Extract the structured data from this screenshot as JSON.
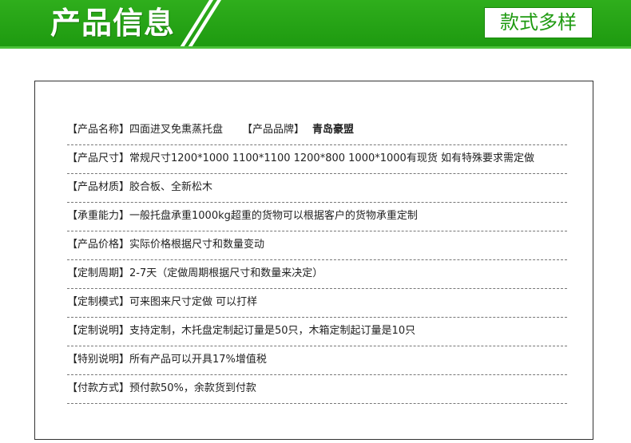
{
  "banner": {
    "title": "产品信息",
    "badge": "款式多样"
  },
  "rows": [
    {
      "label": "【产品名称】",
      "value": "四面进叉免熏蒸托盘",
      "label2": "【产品品牌】",
      "value2": "青岛豪盟"
    },
    {
      "label": "【产品尺寸】",
      "value": "常规尺寸1200*1000  1100*1100 1200*800 1000*1000有现货 如有特殊要求需定做"
    },
    {
      "label": "【产品材质】",
      "value": "胶合板、全新松木"
    },
    {
      "label": "【承重能力】",
      "value": "一般托盘承重1000kg超重的货物可以根据客户的货物承重定制"
    },
    {
      "label": "【产品价格】",
      "value": "实际价格根据尺寸和数量变动"
    },
    {
      "label": "【定制周期】",
      "value": "2-7天（定做周期根据尺寸和数量来决定）"
    },
    {
      "label": "【定制模式】",
      "value": "可来图来尺寸定做 可以打样"
    },
    {
      "label": "【定制说明】",
      "value": "支持定制，木托盘定制起订量是50只，木箱定制起订量是10只"
    },
    {
      "label": "【特别说明】",
      "value": "所有产品可以开具17%增值税"
    },
    {
      "label": "【付款方式】",
      "value": "预付款50%，余款货到付款"
    }
  ]
}
